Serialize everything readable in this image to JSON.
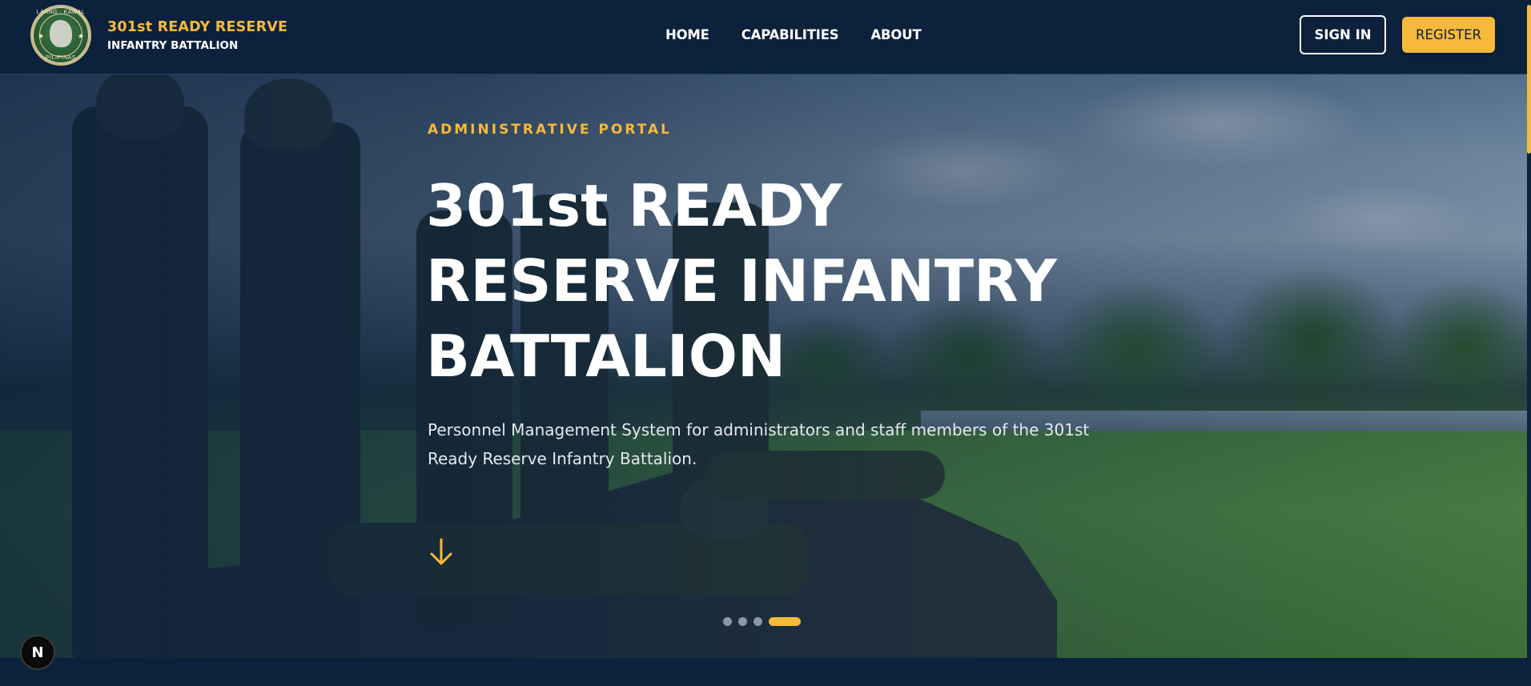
{
  "header": {
    "brand_title": "301st READY RESERVE",
    "brand_subtitle": "INFANTRY BATTALION",
    "logo_text_top": "LAANG · KAWAL",
    "logo_text_bottom": "PILIPINAS",
    "nav": [
      "HOME",
      "CAPABILITIES",
      "ABOUT"
    ],
    "sign_in_label": "SIGN IN",
    "register_label": "REGISTER"
  },
  "hero": {
    "eyebrow": "ADMINISTRATIVE PORTAL",
    "headline_lines": [
      "301st READY",
      "RESERVE INFANTRY",
      "BATTALION"
    ],
    "lede": "Personnel Management System for administrators and staff members of the 301st Ready Reserve Infantry Battalion.",
    "carousel": {
      "slide_count": 4,
      "active_index": 3
    }
  },
  "badge_letter": "N",
  "colors": {
    "navy": "#0c213c",
    "accent_gold": "#f6b93b",
    "white": "#ffffff"
  },
  "icons": [
    "emblem-logo",
    "arrow-down-icon",
    "carousel-dot",
    "nextjs-badge-icon"
  ]
}
